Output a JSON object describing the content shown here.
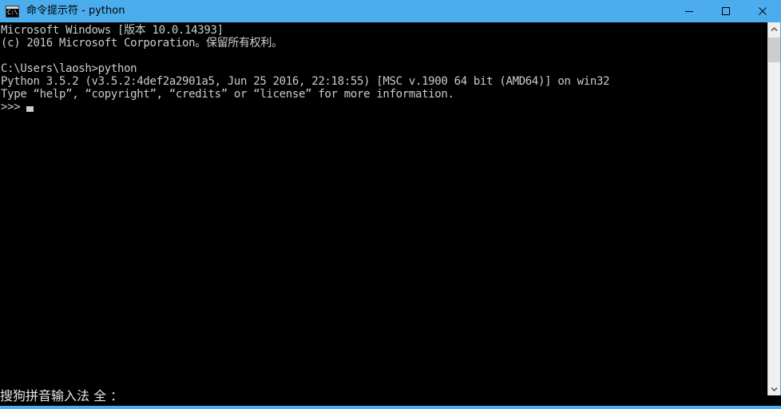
{
  "window": {
    "title": "命令提示符 - python",
    "icon": "cmd-console-icon",
    "icon_glyph": "C:\\.",
    "titlebar_color": "#4cadee",
    "background_color": "#000000",
    "text_color": "#cccccc"
  },
  "window_controls": {
    "minimize_label": "最小化",
    "maximize_label": "最大化",
    "close_label": "关闭"
  },
  "console": {
    "lines": [
      "Microsoft Windows [版本 10.0.14393]",
      "(c) 2016 Microsoft Corporation。保留所有权利。",
      "",
      "C:\\Users\\laosh>python",
      "Python 3.5.2 (v3.5.2:4def2a2901a5, Jun 25 2016, 22:18:55) [MSC v.1900 64 bit (AMD64)] on win32",
      "Type “help”, “copyright”, “credits” or “license” for more information.",
      ">>>"
    ],
    "prompt": ">>>",
    "cursor_visible": true
  },
  "scrollbar": {
    "up_arrow": "chevron-up-icon",
    "down_arrow": "chevron-down-icon",
    "thumb_color": "#cdcdcd",
    "track_color": "#f0f0f0"
  },
  "ime": {
    "status_text": "搜狗拼音输入法 全 ："
  }
}
